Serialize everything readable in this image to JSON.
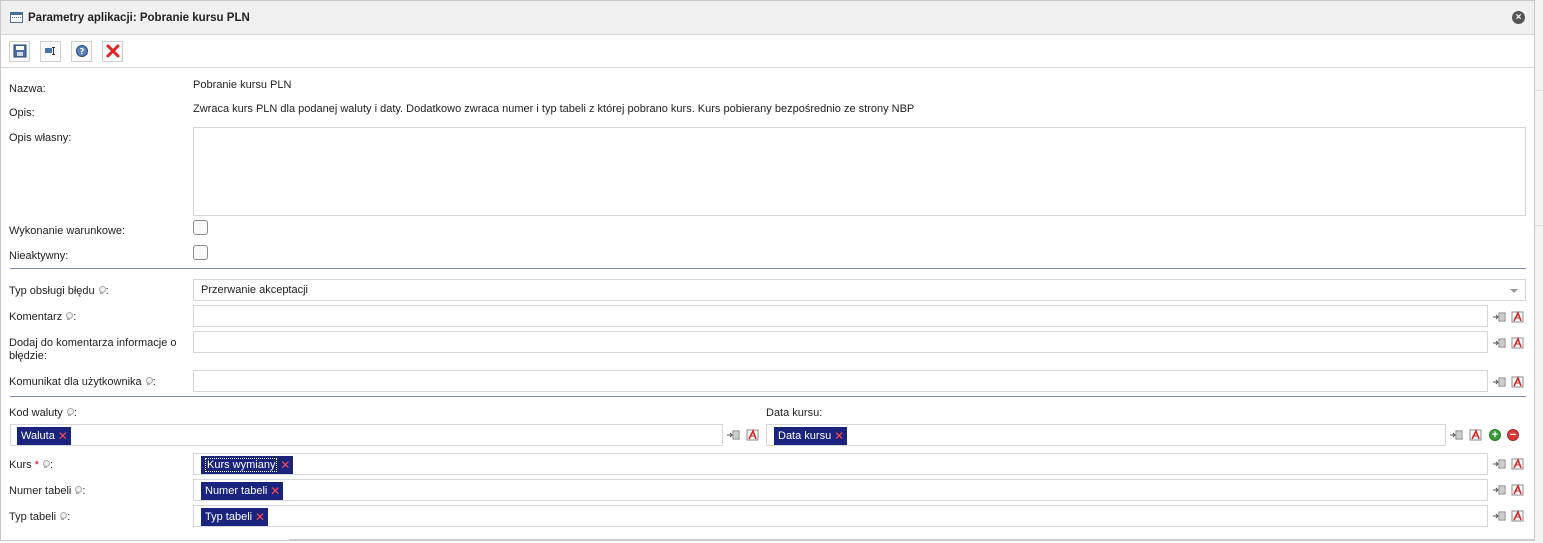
{
  "window": {
    "title": "Parametry aplikacji: Pobranie kursu PLN"
  },
  "toolbar": {
    "buttons": [
      {
        "name": "save-icon"
      },
      {
        "name": "rename-icon"
      },
      {
        "name": "help-icon"
      },
      {
        "name": "delete-icon"
      }
    ]
  },
  "form": {
    "nazwa_label": "Nazwa:",
    "nazwa_value": "Pobranie kursu PLN",
    "opis_label": "Opis:",
    "opis_value": "Zwraca kurs PLN dla podanej waluty i daty. Dodatkowo zwraca numer i typ tabeli z której pobrano kurs. Kurs pobierany bezpośrednio ze strony NBP",
    "opis_wlasny_label": "Opis własny:",
    "opis_wlasny_value": "",
    "wykonanie_label": "Wykonanie warunkowe:",
    "wykonanie_checked": false,
    "nieaktywny_label": "Nieaktywny:",
    "nieaktywny_checked": false,
    "typ_obslugi_label": "Typ obsługi błędu",
    "typ_obslugi_value": "Przerwanie akceptacji",
    "komentarz_label": "Komentarz",
    "komentarz_value": "",
    "dodaj_label_1": "Dodaj do komentarza informacje o",
    "dodaj_label_2": "błędzie:",
    "dodaj_value": "",
    "komunikat_label": "Komunikat dla użytkownika",
    "komunikat_value": "",
    "kod_waluty_label": "Kod waluty",
    "kod_waluty_tag": "Waluta",
    "data_kursu_label": "Data kursu:",
    "data_kursu_tag": "Data kursu",
    "kurs_label": "Kurs",
    "kurs_required": "*",
    "kurs_tag": "Kurs wymiany",
    "numer_tabeli_label": "Numer tabeli",
    "numer_tabeli_tag": "Numer tabeli",
    "typ_tabeli_label": "Typ tabeli",
    "typ_tabeli_tag": "Typ tabeli",
    "colon": ":",
    "remove_glyph": "✕"
  },
  "colors": {
    "tag_bg": "#1a237e",
    "tag_remove": "#ff4a4a",
    "separator": "#7a8ba6",
    "add": "#3a9a3a",
    "remove": "#d83a3a"
  }
}
